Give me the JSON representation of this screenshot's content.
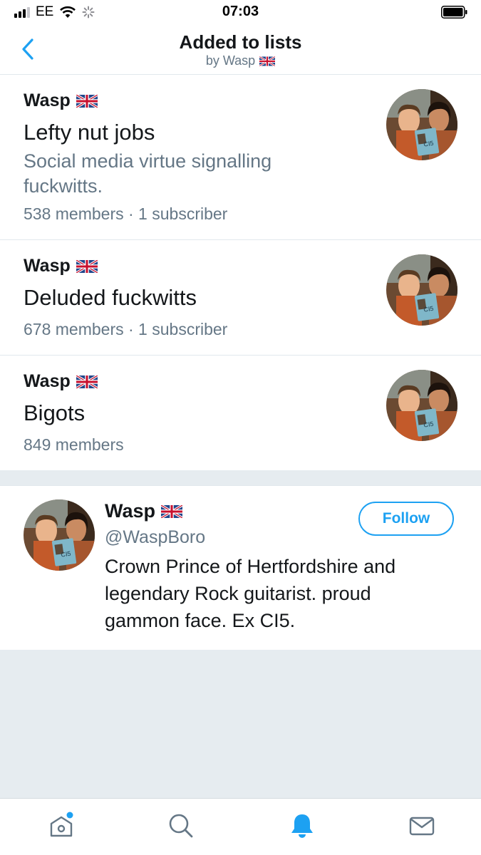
{
  "status_bar": {
    "carrier": "EE",
    "time": "07:03"
  },
  "nav": {
    "title": "Added to lists",
    "subtitle": "by Wasp"
  },
  "lists": [
    {
      "owner": "Wasp",
      "name": "Lefty nut jobs",
      "description": "Social media virtue signalling fuckwitts.",
      "meta": "538 members · 1 subscriber"
    },
    {
      "owner": "Wasp",
      "name": "Deluded fuckwitts",
      "meta": "678 members · 1 subscriber"
    },
    {
      "owner": "Wasp",
      "name": "Bigots",
      "meta": "849 members"
    }
  ],
  "profile": {
    "name": "Wasp",
    "handle": "@WaspBoro",
    "bio": "Crown Prince of Hertfordshire and legendary Rock guitarist. proud gammon face. Ex CI5.",
    "follow_label": "Follow",
    "avatar_text": "CI5"
  },
  "tabs": [
    {
      "icon": "home-icon",
      "active": false,
      "has_dot": true
    },
    {
      "icon": "search-icon",
      "active": false
    },
    {
      "icon": "bell-icon",
      "active": true
    },
    {
      "icon": "mail-icon",
      "active": false
    }
  ],
  "colors": {
    "accent": "#1da1f2",
    "secondary_text": "#657786",
    "band": "#e6ecf0"
  }
}
